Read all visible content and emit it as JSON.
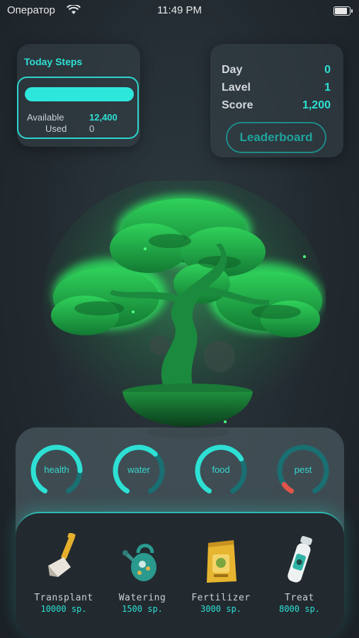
{
  "status_bar": {
    "carrier": "Оператор",
    "time": "11:49 PM",
    "battery_level": 0.95
  },
  "steps": {
    "title": "Today Steps",
    "progress": 1.0,
    "available_label": "Available",
    "available_value": "12,400",
    "used_label": "Used",
    "used_value": "0"
  },
  "stats": {
    "day_label": "Day",
    "day_value": "0",
    "level_label": "Lavel",
    "level_value": "1",
    "score_label": "Score",
    "score_value": "1,200",
    "leaderboard_label": "Leaderboard"
  },
  "meters": [
    {
      "label": "health",
      "level": 0.8
    },
    {
      "label": "water",
      "level": 0.65
    },
    {
      "label": "food",
      "level": 0.7
    },
    {
      "label": "pest",
      "level": 0.08
    }
  ],
  "tools": [
    {
      "name": "Transplant",
      "cost": "10000 sp.",
      "icon": "shovel-icon"
    },
    {
      "name": "Watering",
      "cost": "1500 sp.",
      "icon": "watering-can-icon"
    },
    {
      "name": "Fertilizer",
      "cost": "3000 sp.",
      "icon": "fertilizer-bag-icon"
    },
    {
      "name": "Treat",
      "cost": "8000 sp.",
      "icon": "spray-bottle-icon"
    }
  ],
  "colors": {
    "accent": "#2ee0d4",
    "accent_dark": "#1a6f72",
    "pest_warning": "#e2544a",
    "tree_green": "#1fa84a"
  }
}
